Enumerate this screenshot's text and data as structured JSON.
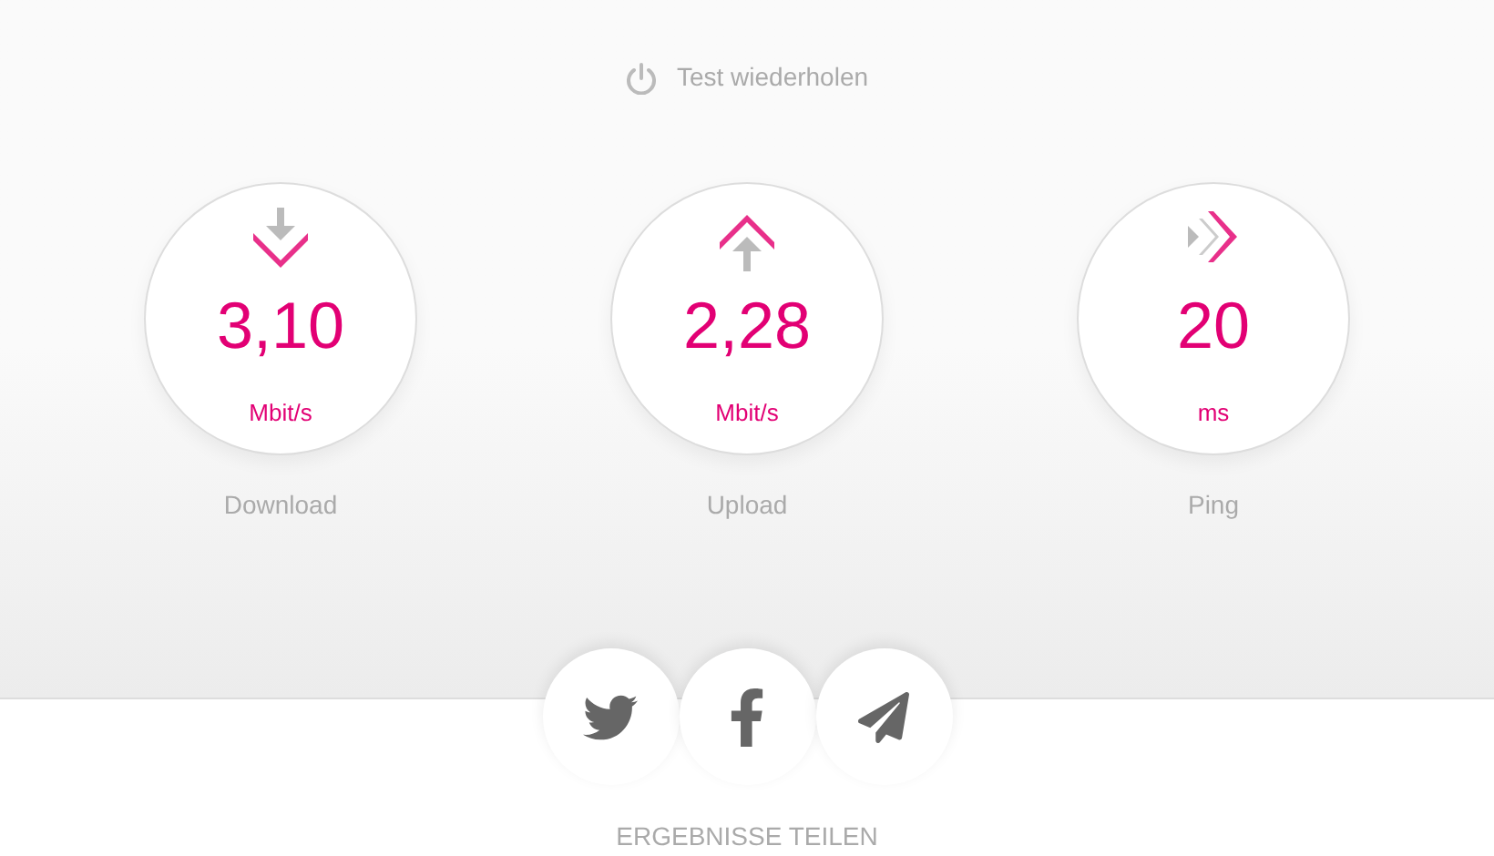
{
  "repeat_button": {
    "label": "Test wiederholen"
  },
  "metrics": [
    {
      "kind": "download",
      "value": "3,10",
      "unit": "Mbit/s",
      "label": "Download"
    },
    {
      "kind": "upload",
      "value": "2,28",
      "unit": "Mbit/s",
      "label": "Upload"
    },
    {
      "kind": "ping",
      "value": "20",
      "unit": "ms",
      "label": "Ping"
    }
  ],
  "share_buttons": [
    {
      "kind": "twitter"
    },
    {
      "kind": "facebook"
    },
    {
      "kind": "mail"
    }
  ],
  "share_label": "ERGEBNISSE TEILEN"
}
